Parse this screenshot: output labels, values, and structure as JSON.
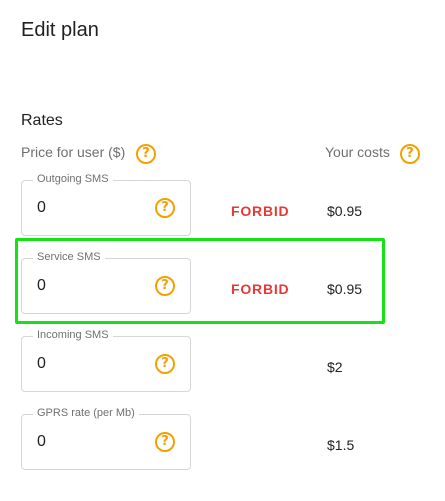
{
  "header": {
    "title": "Edit plan"
  },
  "rates": {
    "section_title": "Rates",
    "price_header": "Price for user ($)",
    "costs_header": "Your costs",
    "rows": [
      {
        "label": "Outgoing SMS",
        "value": "0",
        "action": "FORBID",
        "cost": "$0.95"
      },
      {
        "label": "Service SMS",
        "value": "0",
        "action": "FORBID",
        "cost": "$0.95"
      },
      {
        "label": "Incoming SMS",
        "value": "0",
        "action": "",
        "cost": "$2"
      },
      {
        "label": "GPRS rate (per Mb)",
        "value": "0",
        "action": "",
        "cost": "$1.5"
      }
    ]
  },
  "icons": {
    "help": "help-circle-icon",
    "help_glyph": "?"
  },
  "colors": {
    "help": "#f5a000",
    "forbid": "#e53935",
    "highlight": "#16e016"
  }
}
